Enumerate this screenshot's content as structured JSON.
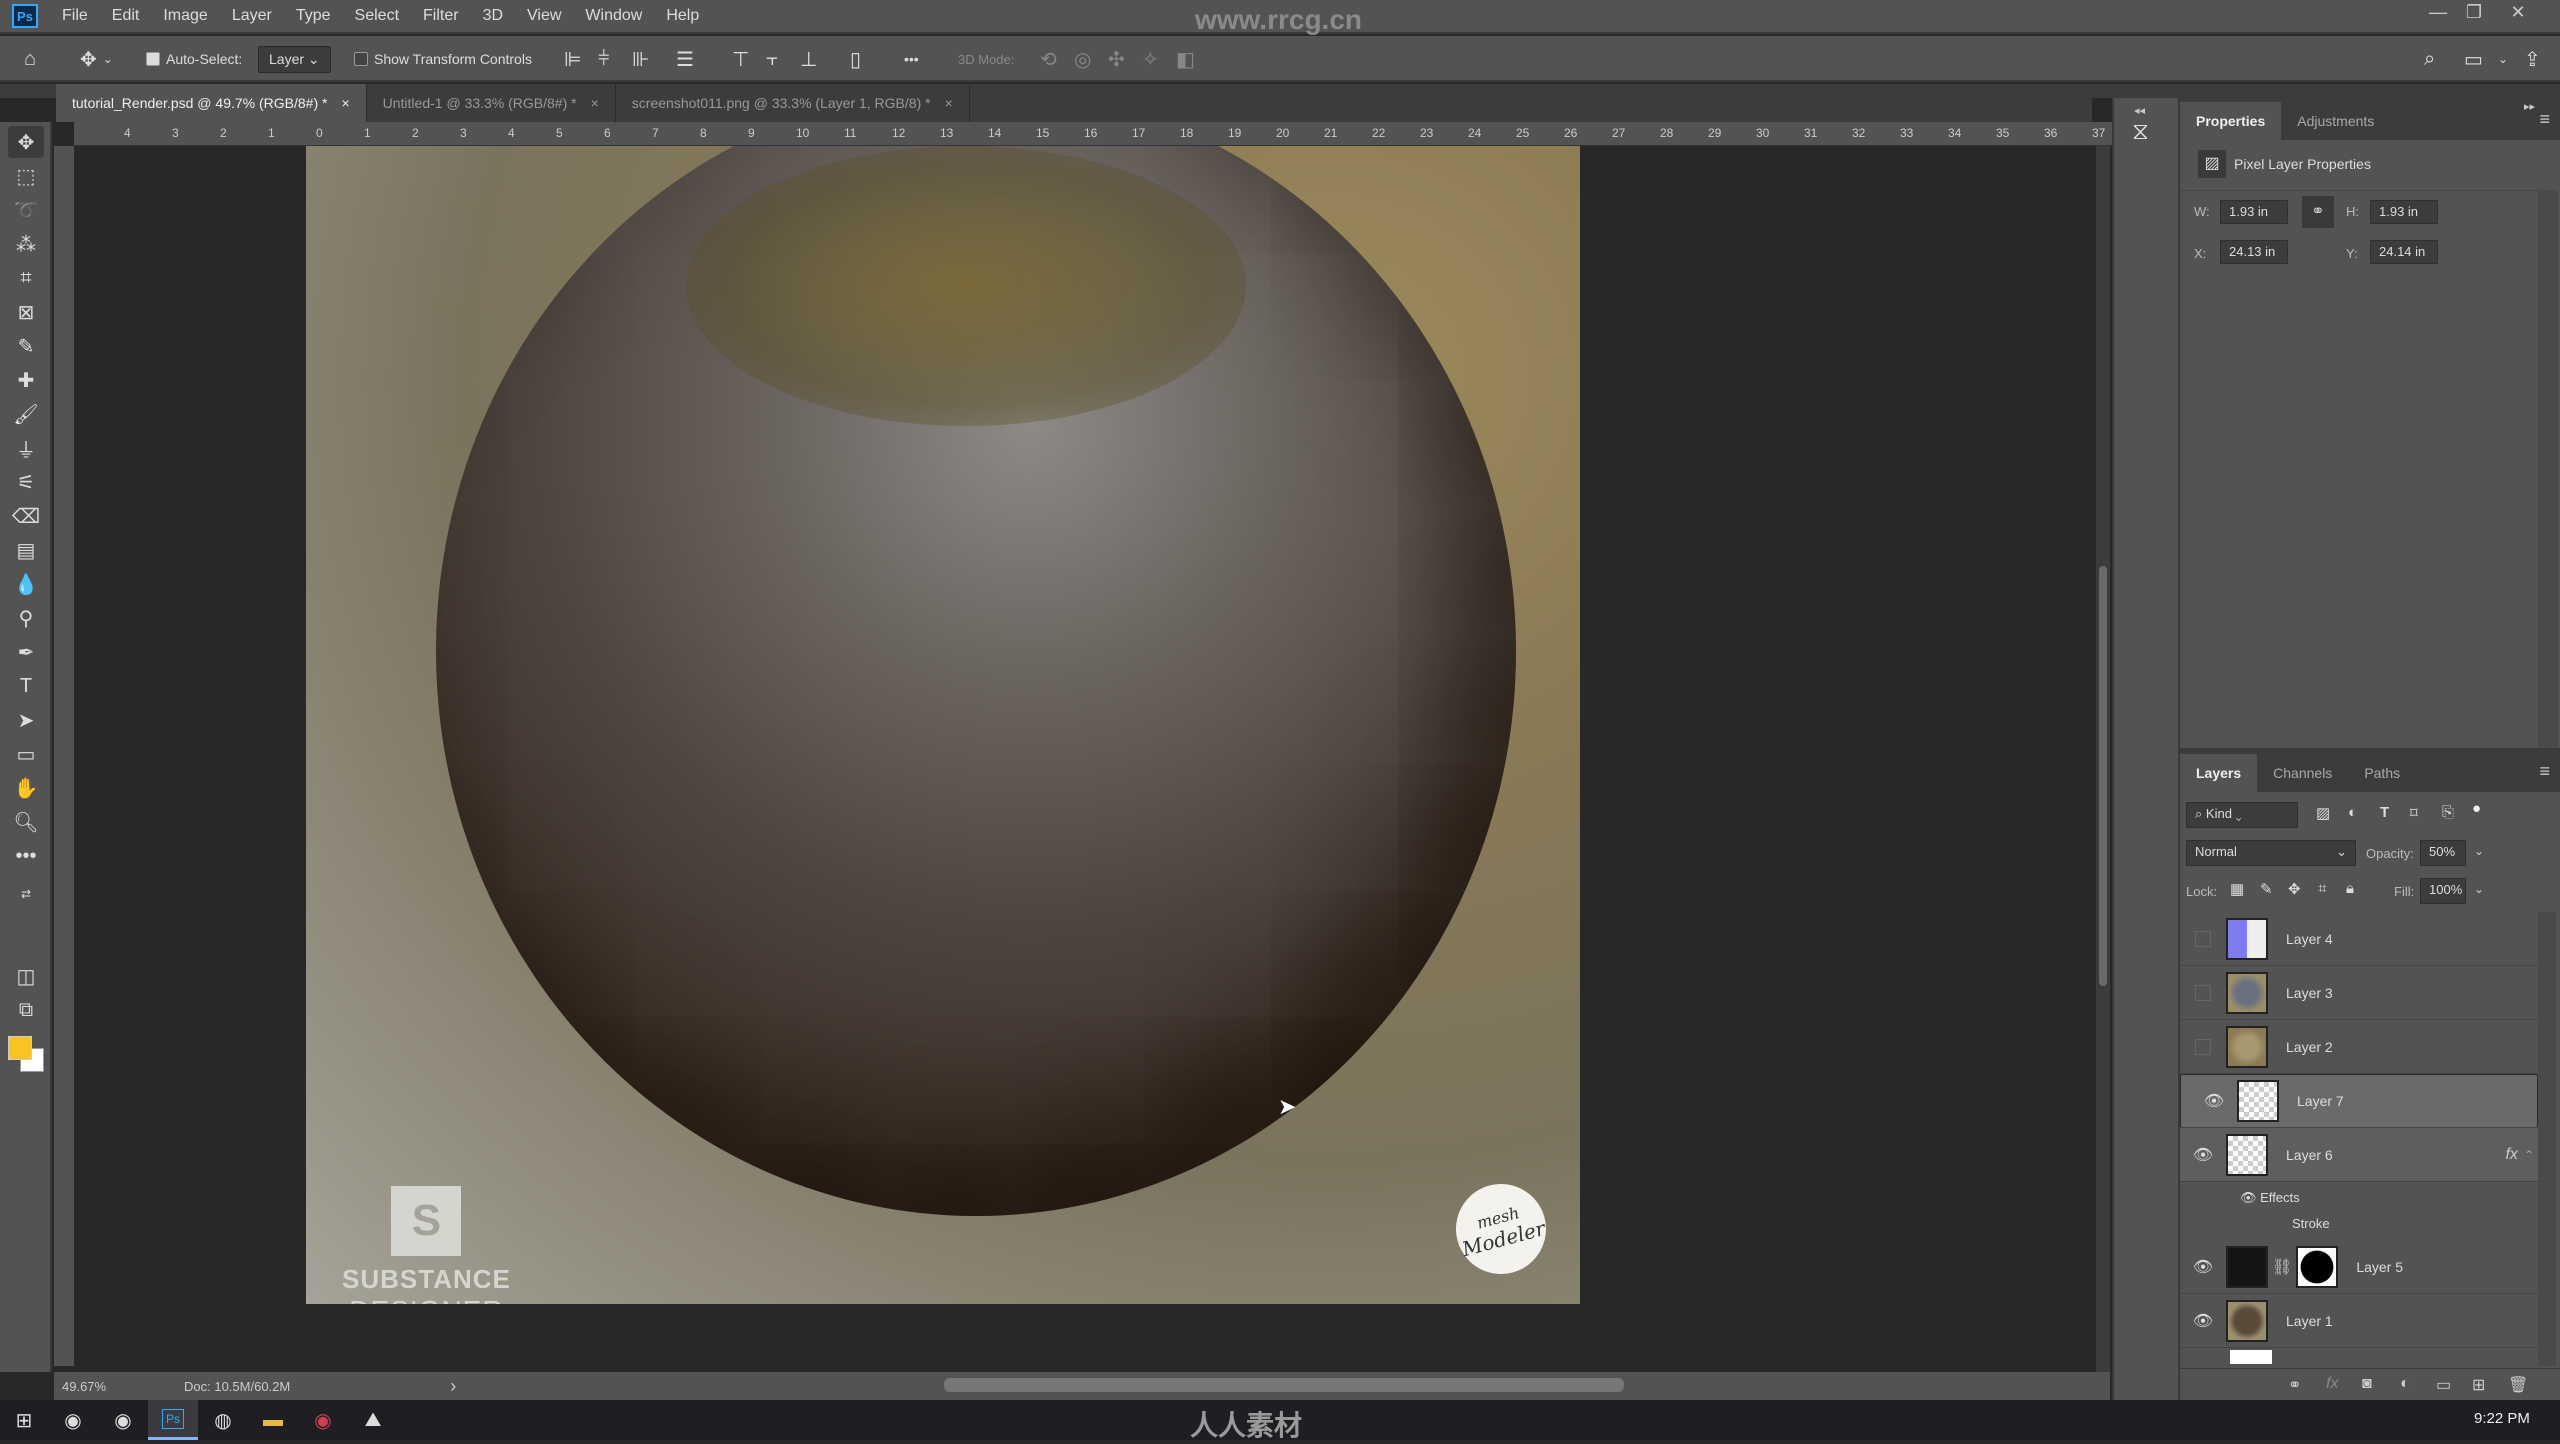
{
  "app": {
    "logo": "Ps",
    "watermark_url": "www.rrcg.cn",
    "watermark_bottom": "人人素材"
  },
  "menu": [
    "File",
    "Edit",
    "Image",
    "Layer",
    "Type",
    "Select",
    "Filter",
    "3D",
    "View",
    "Window",
    "Help"
  ],
  "window_controls": {
    "minimize": "—",
    "restore": "❐",
    "close": "✕"
  },
  "options_bar": {
    "auto_select_label": "Auto-Select:",
    "auto_select_checked": true,
    "auto_select_target": "Layer",
    "show_transform_label": "Show Transform Controls",
    "show_transform_checked": false,
    "more": "•••",
    "mode_3d_label": "3D Mode:"
  },
  "doc_tabs": [
    {
      "label": "tutorial_Render.psd @ 49.7% (RGB/8#) *",
      "active": true
    },
    {
      "label": "Untitled-1 @ 33.3% (RGB/8#) *",
      "active": false
    },
    {
      "label": "screenshot011.png @ 33.3% (Layer 1, RGB/8) *",
      "active": false
    }
  ],
  "ruler_top": [
    "4",
    "3",
    "2",
    "1",
    "0",
    "1",
    "2",
    "3",
    "4",
    "5",
    "6",
    "7",
    "8",
    "9",
    "10",
    "11",
    "12",
    "13",
    "14",
    "15",
    "16",
    "17",
    "18",
    "19",
    "20",
    "21",
    "22",
    "23",
    "24",
    "25",
    "26",
    "27",
    "28",
    "29",
    "30",
    "31",
    "32",
    "33",
    "34",
    "35",
    "36",
    "37"
  ],
  "artwork": {
    "logo_left_line1": "SUBSTANCE",
    "logo_left_line2": "DESIGNER",
    "logo_left_icon": "S",
    "logo_right_line1": "mesh",
    "logo_right_line2": "Modeler"
  },
  "status": {
    "zoom": "49.67%",
    "doc": "Doc: 10.5M/60.2M",
    "arrow": "›"
  },
  "properties_panel": {
    "tabs": [
      "Properties",
      "Adjustments"
    ],
    "title": "Pixel Layer Properties",
    "w_label": "W:",
    "w": "1.93 in",
    "h_label": "H:",
    "h": "1.93 in",
    "x_label": "X:",
    "x": "24.13 in",
    "y_label": "Y:",
    "y": "24.14 in"
  },
  "layers_panel": {
    "tabs": [
      "Layers",
      "Channels",
      "Paths"
    ],
    "filter_kind": "Kind",
    "blend_mode": "Normal",
    "opacity_label": "Opacity:",
    "opacity": "50%",
    "lock_label": "Lock:",
    "fill_label": "Fill:",
    "fill": "100%",
    "layers": [
      {
        "name": "Layer 4",
        "visible": false
      },
      {
        "name": "Layer 3",
        "visible": false
      },
      {
        "name": "Layer 2",
        "visible": false
      },
      {
        "name": "Layer 7",
        "visible": true,
        "selected": true
      },
      {
        "name": "Layer 6",
        "visible": true,
        "fx": "fx",
        "effects_label": "Effects",
        "effect": "Stroke"
      },
      {
        "name": "Layer 5",
        "visible": true,
        "has_mask": true
      },
      {
        "name": "Layer 1",
        "visible": true
      }
    ]
  },
  "taskbar": {
    "time": "9:22 PM"
  }
}
